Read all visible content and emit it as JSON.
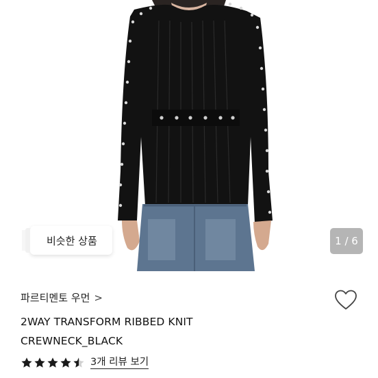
{
  "product": {
    "image_counter": "1 / 6",
    "similar_products_label": "비슷한 상품",
    "store_name": "파르티멘토 우먼",
    "store_chevron": ">",
    "title_line1": "2WAY TRANSFORM RIBBED KNIT",
    "title_line2": "CREWNECK_BLACK",
    "rating": 4.5,
    "review_link_label": "3개 리뷰 보기"
  },
  "icons": {
    "wishlist": "heart-outline-icon",
    "star": "star-icon",
    "chevron": "chevron-right-icon"
  },
  "colors": {
    "star": "#1a1a1a",
    "counter_bg": "#8a8a8a",
    "text": "#111111"
  }
}
